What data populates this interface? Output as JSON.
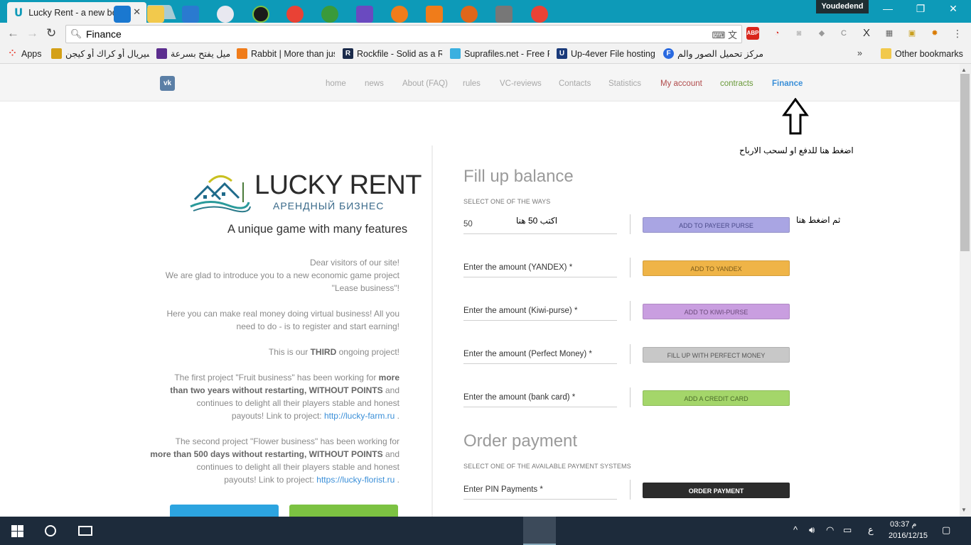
{
  "browser": {
    "tab_title": "Lucky Rent - a new best",
    "user_badge": "Youdedend",
    "address": "Finance",
    "bookmarks": [
      {
        "label": "Apps",
        "color": "#e94235"
      },
      {
        "label": "سيريال أو كراك أو كيجن",
        "color": "#d4a017"
      },
      {
        "label": "اميل يفتح بسرعة",
        "color": "#5b2d8e"
      },
      {
        "label": "Rabbit | More than jus",
        "color": "#f07c1a"
      },
      {
        "label": "Rockfile - Solid as a R",
        "color": "#1a2a4a"
      },
      {
        "label": "Suprafiles.net - Free F",
        "color": "#3ab0e0"
      },
      {
        "label": "Up-4ever File hosting",
        "color": "#1a3a7a"
      },
      {
        "label": "مركز تحميل الصور والم",
        "color": "#2a6ae0"
      }
    ],
    "other_bookmarks": "Other bookmarks"
  },
  "site": {
    "vk": "vk",
    "nav": [
      "home",
      "news",
      "About (FAQ)",
      "rules",
      "VC-reviews",
      "Contacts",
      "Statistics",
      "My account",
      "contracts",
      "Finance"
    ],
    "brand_name": "LUCKY RENT",
    "brand_sub": "АРЕНДНЫЙ БИЗНЕС",
    "tagline": "A unique game with many features",
    "intro": {
      "p1_l1": "Dear visitors of our site!",
      "p1_l2": "We are glad to introduce you to a new economic game project",
      "p1_l3": "\"Lease business\"!",
      "p2_l1": "Here you can make real money doing virtual business! All you",
      "p2_l2": "need to do - is to register and start earning!",
      "p3_pre": "This is our ",
      "p3_bold": "THIRD",
      "p3_post": " ongoing project!",
      "p4_l1_pre": "The first project \"Fruit business\" has been working for ",
      "p4_l1_bold": "more",
      "p4_l2_bold": "than two years without restarting, WITHOUT POINTS",
      "p4_l2_post": " and",
      "p4_l3": "continues to delight all their players stable and honest",
      "p4_l4_pre": "payouts! Link to project: ",
      "p4_l4_link": "http://lucky-farm.ru",
      "p4_l4_post": " .",
      "p5_l1": "The second project \"Flower business\" has been working for",
      "p5_l2_bold": "more than 500 days without restarting, WITHOUT POINTS",
      "p5_l2_post": " and",
      "p5_l3": "continues to delight all their players stable and honest",
      "p5_l4_pre": "payouts! Link to project: ",
      "p5_l4_link": "https://lucky-florist.ru",
      "p5_l4_post": " ."
    },
    "fill_title": "Fill up balance",
    "fill_sub": "SELECT ONE OF THE WAYS",
    "rows": [
      {
        "field": "50",
        "button": "ADD TO PAYEER PURSE"
      },
      {
        "field": "Enter the amount (YANDEX) *",
        "button": "ADD TO YANDEX"
      },
      {
        "field": "Enter the amount (Kiwi-purse) *",
        "button": "ADD TO KIWI-PURSE"
      },
      {
        "field": "Enter the amount (Perfect Money) *",
        "button": "FILL UP WITH PERFECT MONEY"
      },
      {
        "field": "Enter the amount (bank card) *",
        "button": "ADD A CREDIT CARD"
      }
    ],
    "order_title": "Order payment",
    "order_sub": "SELECT ONE OF THE AVAILABLE PAYMENT SYSTEMS",
    "order_field": "Enter PIN Payments *",
    "order_button": "ORDER PAYMENT"
  },
  "annotations": {
    "finance_hint": "اضغط هنا للدفع او لسحب الارباح",
    "amount_hint": "اكتب 50 هنا",
    "button_hint": "ثم اضغط هنا"
  },
  "taskbar": {
    "time": "03:37 م",
    "date": "2016/12/15",
    "lang": "ع"
  }
}
